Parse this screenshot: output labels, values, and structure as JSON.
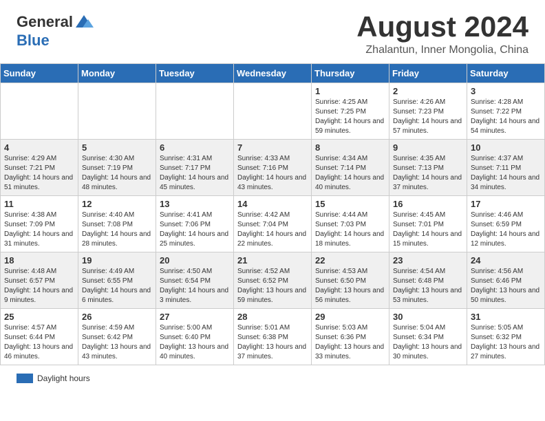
{
  "header": {
    "logo": {
      "general": "General",
      "blue": "Blue"
    },
    "title": "August 2024",
    "location": "Zhalantun, Inner Mongolia, China"
  },
  "days_of_week": [
    "Sunday",
    "Monday",
    "Tuesday",
    "Wednesday",
    "Thursday",
    "Friday",
    "Saturday"
  ],
  "footer": {
    "label": "Daylight hours"
  },
  "weeks": [
    [
      {
        "day": "",
        "info": ""
      },
      {
        "day": "",
        "info": ""
      },
      {
        "day": "",
        "info": ""
      },
      {
        "day": "",
        "info": ""
      },
      {
        "day": "1",
        "info": "Sunrise: 4:25 AM\nSunset: 7:25 PM\nDaylight: 14 hours and 59 minutes."
      },
      {
        "day": "2",
        "info": "Sunrise: 4:26 AM\nSunset: 7:23 PM\nDaylight: 14 hours and 57 minutes."
      },
      {
        "day": "3",
        "info": "Sunrise: 4:28 AM\nSunset: 7:22 PM\nDaylight: 14 hours and 54 minutes."
      }
    ],
    [
      {
        "day": "4",
        "info": "Sunrise: 4:29 AM\nSunset: 7:21 PM\nDaylight: 14 hours and 51 minutes."
      },
      {
        "day": "5",
        "info": "Sunrise: 4:30 AM\nSunset: 7:19 PM\nDaylight: 14 hours and 48 minutes."
      },
      {
        "day": "6",
        "info": "Sunrise: 4:31 AM\nSunset: 7:17 PM\nDaylight: 14 hours and 45 minutes."
      },
      {
        "day": "7",
        "info": "Sunrise: 4:33 AM\nSunset: 7:16 PM\nDaylight: 14 hours and 43 minutes."
      },
      {
        "day": "8",
        "info": "Sunrise: 4:34 AM\nSunset: 7:14 PM\nDaylight: 14 hours and 40 minutes."
      },
      {
        "day": "9",
        "info": "Sunrise: 4:35 AM\nSunset: 7:13 PM\nDaylight: 14 hours and 37 minutes."
      },
      {
        "day": "10",
        "info": "Sunrise: 4:37 AM\nSunset: 7:11 PM\nDaylight: 14 hours and 34 minutes."
      }
    ],
    [
      {
        "day": "11",
        "info": "Sunrise: 4:38 AM\nSunset: 7:09 PM\nDaylight: 14 hours and 31 minutes."
      },
      {
        "day": "12",
        "info": "Sunrise: 4:40 AM\nSunset: 7:08 PM\nDaylight: 14 hours and 28 minutes."
      },
      {
        "day": "13",
        "info": "Sunrise: 4:41 AM\nSunset: 7:06 PM\nDaylight: 14 hours and 25 minutes."
      },
      {
        "day": "14",
        "info": "Sunrise: 4:42 AM\nSunset: 7:04 PM\nDaylight: 14 hours and 22 minutes."
      },
      {
        "day": "15",
        "info": "Sunrise: 4:44 AM\nSunset: 7:03 PM\nDaylight: 14 hours and 18 minutes."
      },
      {
        "day": "16",
        "info": "Sunrise: 4:45 AM\nSunset: 7:01 PM\nDaylight: 14 hours and 15 minutes."
      },
      {
        "day": "17",
        "info": "Sunrise: 4:46 AM\nSunset: 6:59 PM\nDaylight: 14 hours and 12 minutes."
      }
    ],
    [
      {
        "day": "18",
        "info": "Sunrise: 4:48 AM\nSunset: 6:57 PM\nDaylight: 14 hours and 9 minutes."
      },
      {
        "day": "19",
        "info": "Sunrise: 4:49 AM\nSunset: 6:55 PM\nDaylight: 14 hours and 6 minutes."
      },
      {
        "day": "20",
        "info": "Sunrise: 4:50 AM\nSunset: 6:54 PM\nDaylight: 14 hours and 3 minutes."
      },
      {
        "day": "21",
        "info": "Sunrise: 4:52 AM\nSunset: 6:52 PM\nDaylight: 13 hours and 59 minutes."
      },
      {
        "day": "22",
        "info": "Sunrise: 4:53 AM\nSunset: 6:50 PM\nDaylight: 13 hours and 56 minutes."
      },
      {
        "day": "23",
        "info": "Sunrise: 4:54 AM\nSunset: 6:48 PM\nDaylight: 13 hours and 53 minutes."
      },
      {
        "day": "24",
        "info": "Sunrise: 4:56 AM\nSunset: 6:46 PM\nDaylight: 13 hours and 50 minutes."
      }
    ],
    [
      {
        "day": "25",
        "info": "Sunrise: 4:57 AM\nSunset: 6:44 PM\nDaylight: 13 hours and 46 minutes."
      },
      {
        "day": "26",
        "info": "Sunrise: 4:59 AM\nSunset: 6:42 PM\nDaylight: 13 hours and 43 minutes."
      },
      {
        "day": "27",
        "info": "Sunrise: 5:00 AM\nSunset: 6:40 PM\nDaylight: 13 hours and 40 minutes."
      },
      {
        "day": "28",
        "info": "Sunrise: 5:01 AM\nSunset: 6:38 PM\nDaylight: 13 hours and 37 minutes."
      },
      {
        "day": "29",
        "info": "Sunrise: 5:03 AM\nSunset: 6:36 PM\nDaylight: 13 hours and 33 minutes."
      },
      {
        "day": "30",
        "info": "Sunrise: 5:04 AM\nSunset: 6:34 PM\nDaylight: 13 hours and 30 minutes."
      },
      {
        "day": "31",
        "info": "Sunrise: 5:05 AM\nSunset: 6:32 PM\nDaylight: 13 hours and 27 minutes."
      }
    ]
  ]
}
